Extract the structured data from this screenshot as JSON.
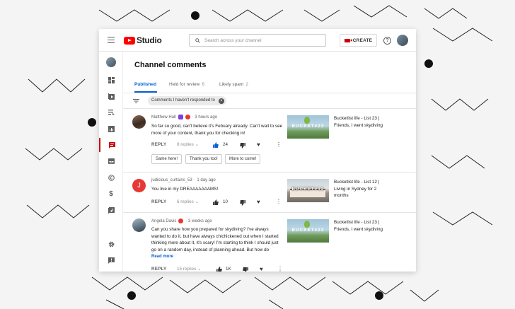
{
  "header": {
    "logo_text": "Studio",
    "search_placeholder": "Search across your channel",
    "create_label": "CREATE",
    "help_glyph": "?"
  },
  "page": {
    "title": "Channel comments",
    "tabs": [
      {
        "label": "Published",
        "count": "",
        "active": true
      },
      {
        "label": "Held for review",
        "count": "6",
        "active": false
      },
      {
        "label": "Likely spam",
        "count": "2",
        "active": false
      }
    ],
    "filter_chip": "Comments I haven't responded to",
    "filter_chip_close": "×"
  },
  "comments": [
    {
      "author": "Matthew Hall",
      "time": "· 3 hours ago",
      "text": "So far so good, can't believe it's Febuary already. Can't wait to see more of your content, thank you for checking in!",
      "reply_label": "REPLY",
      "replies": "8 replies",
      "likes": "24",
      "liked": true,
      "quick_replies": [
        "Same here!",
        "Thank you too!",
        "More to come!"
      ],
      "video_title": "Bucketlist life - List 23 | Friends, I went skydiving",
      "thumb_caption": "BUCKET#23"
    },
    {
      "author": "judicious_curtains_53",
      "time": "· 1 day ago",
      "avatar_letter": "J",
      "text": "You live in my DREAAAAAAAMS!",
      "reply_label": "REPLY",
      "replies": "6 replies",
      "likes": "10",
      "liked": false,
      "video_title": "Bucketlist life - List 12 | Living in Sydney for 2 months",
      "thumb_caption": "BUCKET#12"
    },
    {
      "author": "Angela Davis",
      "time": "· 3 weeks ago",
      "text": "Can you share how you prepared for skydiving? I've always wanted to do it, but have always chichickened out when I started thinking more about it, it's scary! I'm starting to think I should just go on a random day, instead of planning ahead. But how do",
      "read_more": "Read more",
      "reply_label": "REPLY",
      "replies": "15 replies",
      "likes": "1K",
      "liked": false,
      "video_title": "Bucketlist life - List 23 | Friends, I went skydiving",
      "thumb_caption": "BUCKET#23"
    }
  ],
  "colors": {
    "brand_red": "#ff0000",
    "accent_blue": "#065fd4",
    "active_nav": "#cc0000"
  }
}
